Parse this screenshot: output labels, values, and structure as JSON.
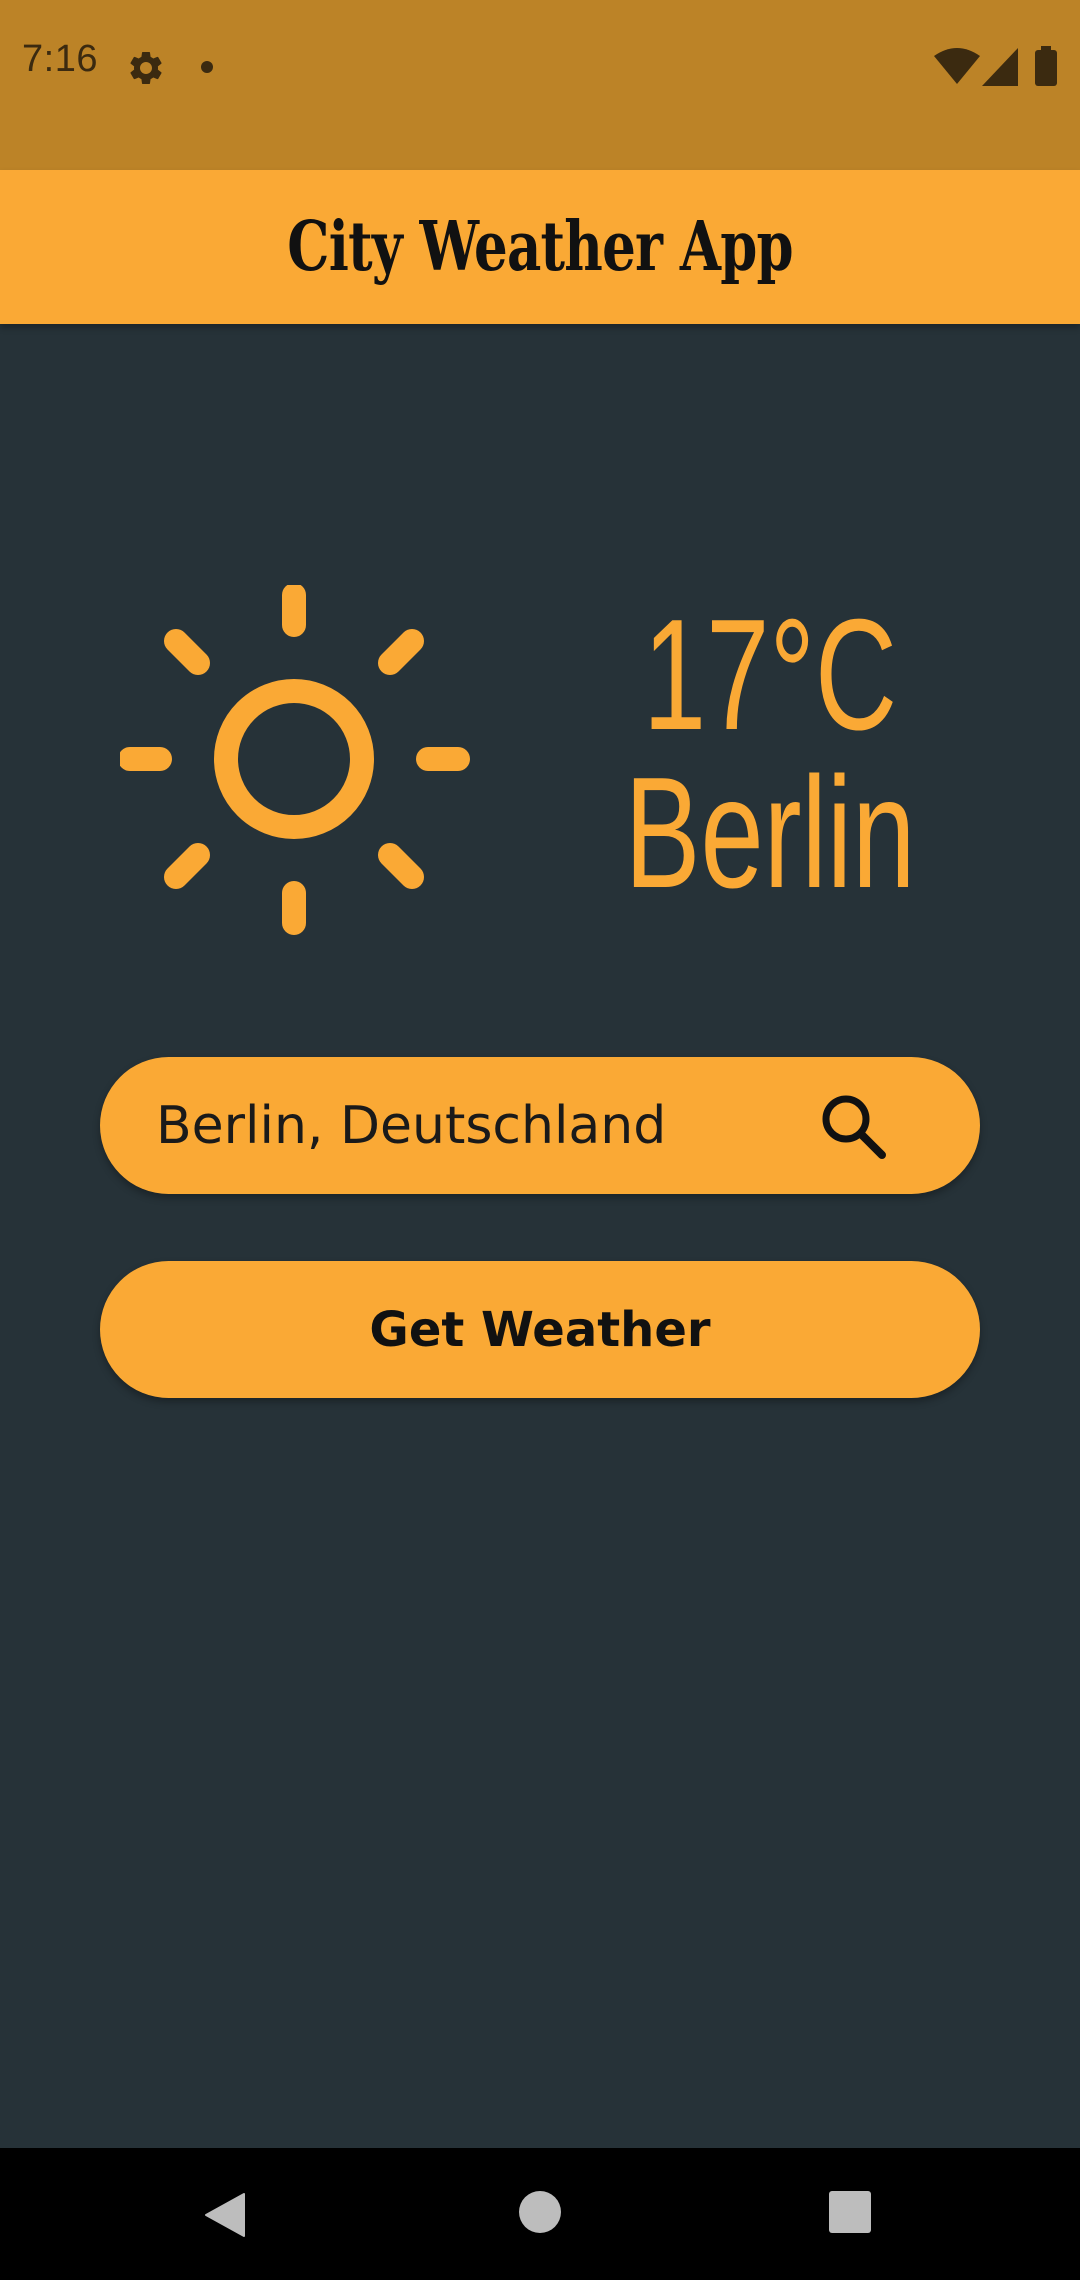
{
  "status_bar": {
    "time": "7:16",
    "icons": [
      "gear-icon",
      "dot-icon",
      "wifi-icon",
      "signal-icon",
      "battery-icon"
    ]
  },
  "app_bar": {
    "title": "City Weather App"
  },
  "weather": {
    "icon": "sun-icon",
    "temperature": "17°C",
    "city": "Berlin"
  },
  "search": {
    "value": "Berlin, Deutschland",
    "icon": "search-icon"
  },
  "button": {
    "label": "Get Weather"
  },
  "nav_bar": {
    "icons": [
      "back-icon",
      "home-icon",
      "recents-icon"
    ]
  },
  "colors": {
    "accent": "#FAA935",
    "status_bar": "#BC8327",
    "background": "#263238",
    "nav_bar": "#000000"
  }
}
